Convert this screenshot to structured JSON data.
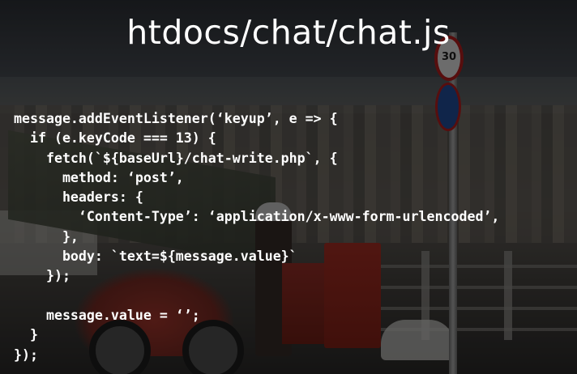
{
  "slide": {
    "title": "htdocs/chat/chat.js",
    "code_lines": [
      "message.addEventListener(‘keyup’, e => {",
      "  if (e.keyCode === 13) {",
      "    fetch(`${baseUrl}/chat-write.php`, {",
      "      method: ‘post’,",
      "      headers: {",
      "        ‘Content-Type’: ‘application/x-www-form-urlencoded’,",
      "      },",
      "      body: `text=${message.value}`",
      "    });",
      "",
      "    message.value = ‘’;",
      "  }",
      "});"
    ],
    "sign_text": "30"
  },
  "colors": {
    "text": "#ffffff",
    "overlay": "rgba(0,0,0,0.55)"
  }
}
